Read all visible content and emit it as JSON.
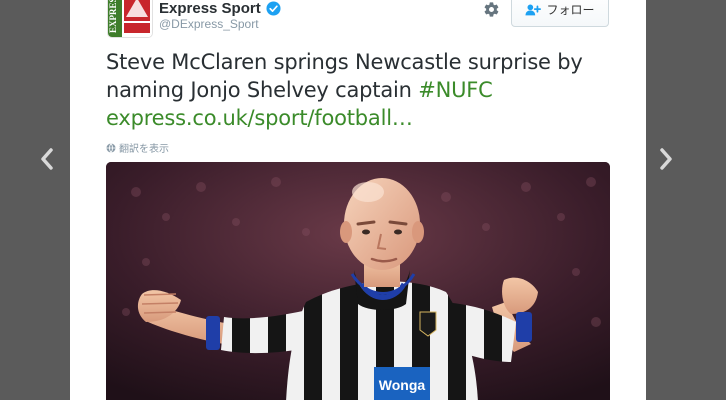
{
  "tweet": {
    "author": {
      "name": "Express Sport",
      "handle": "@DExpress_Sport"
    },
    "follow_label": "フォロー",
    "text_main": "Steve McClaren springs Newcastle surprise by naming Jonjo Shelvey captain ",
    "hashtag": "#NUFC",
    "link": "express.co.uk/sport/football…",
    "translate_label": "翻訳を表示",
    "colors": {
      "link_green": "#3b8b2a",
      "text": "#292f33",
      "muted": "#8899a6",
      "verified_blue": "#1da1f2",
      "backdrop": "#5b5b5b"
    },
    "icons": [
      "chevron-left-icon",
      "chevron-right-icon",
      "verified-badge-icon",
      "gear-icon",
      "follow-person-icon",
      "globe-icon"
    ],
    "photo": {
      "description_shown": "footballer in black-and-white striped kit gesturing with both arms outstretched"
    }
  }
}
